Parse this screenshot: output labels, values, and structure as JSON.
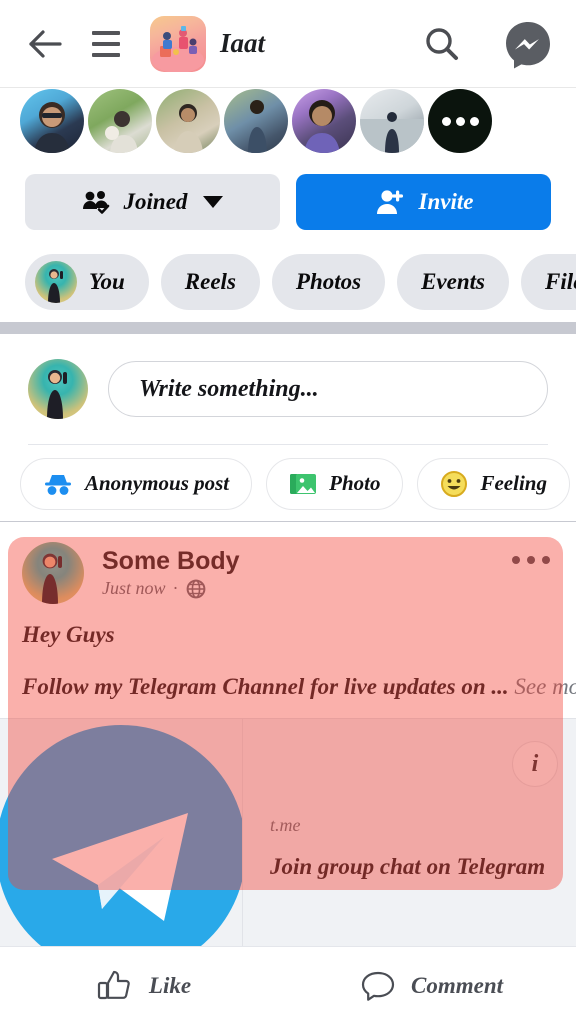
{
  "header": {
    "back_icon": "arrow-left-icon",
    "menu_icon": "hamburger-menu-icon",
    "group_icon": "group-avatar-icon",
    "title": "Iaat",
    "search_icon": "search-icon",
    "messenger_icon": "messenger-icon"
  },
  "members": {
    "avatars": [
      {
        "name": "member-avatar-1"
      },
      {
        "name": "member-avatar-2"
      },
      {
        "name": "member-avatar-3"
      },
      {
        "name": "member-avatar-4"
      },
      {
        "name": "member-avatar-5"
      },
      {
        "name": "member-avatar-6"
      }
    ],
    "more_label": "..."
  },
  "cta": {
    "joined_label": "Joined",
    "joined_icon": "users-check-icon",
    "joined_caret_icon": "chevron-down-icon",
    "invite_label": "Invite",
    "invite_icon": "person-plus-icon",
    "invite_color": "#0a7cea"
  },
  "tabs": [
    {
      "label": "You",
      "has_avatar": true
    },
    {
      "label": "Reels",
      "has_avatar": false
    },
    {
      "label": "Photos",
      "has_avatar": false
    },
    {
      "label": "Events",
      "has_avatar": false
    },
    {
      "label": "Files",
      "has_avatar": false
    }
  ],
  "composer": {
    "avatar_name": "user-avatar",
    "placeholder": "Write something...",
    "actions": [
      {
        "label": "Anonymous post",
        "icon": "incognito-icon",
        "color": "#1c8ef0"
      },
      {
        "label": "Photo",
        "icon": "photo-icon",
        "color": "#2aab5b"
      },
      {
        "label": "Feeling",
        "icon": "smiley-icon",
        "color": "#ecc52e"
      }
    ]
  },
  "post": {
    "author": "Some Body",
    "timestamp": "Just now",
    "separator": "·",
    "privacy_icon": "globe-icon",
    "menu_icon": "more-options-icon",
    "text_line1": "Hey Guys",
    "text_line2": "Follow my Telegram Channel for live updates on ...",
    "see_more": "See more",
    "link_preview": {
      "thumb_icon": "telegram-logo-icon",
      "domain": "t.me",
      "title": "Join group chat on Telegram",
      "info_label": "i",
      "brand_color": "#29a9e9"
    },
    "highlight_color": "#f4433660"
  },
  "footer": {
    "like_label": "Like",
    "like_icon": "thumbs-up-icon",
    "comment_label": "Comment",
    "comment_icon": "comment-bubble-icon"
  }
}
